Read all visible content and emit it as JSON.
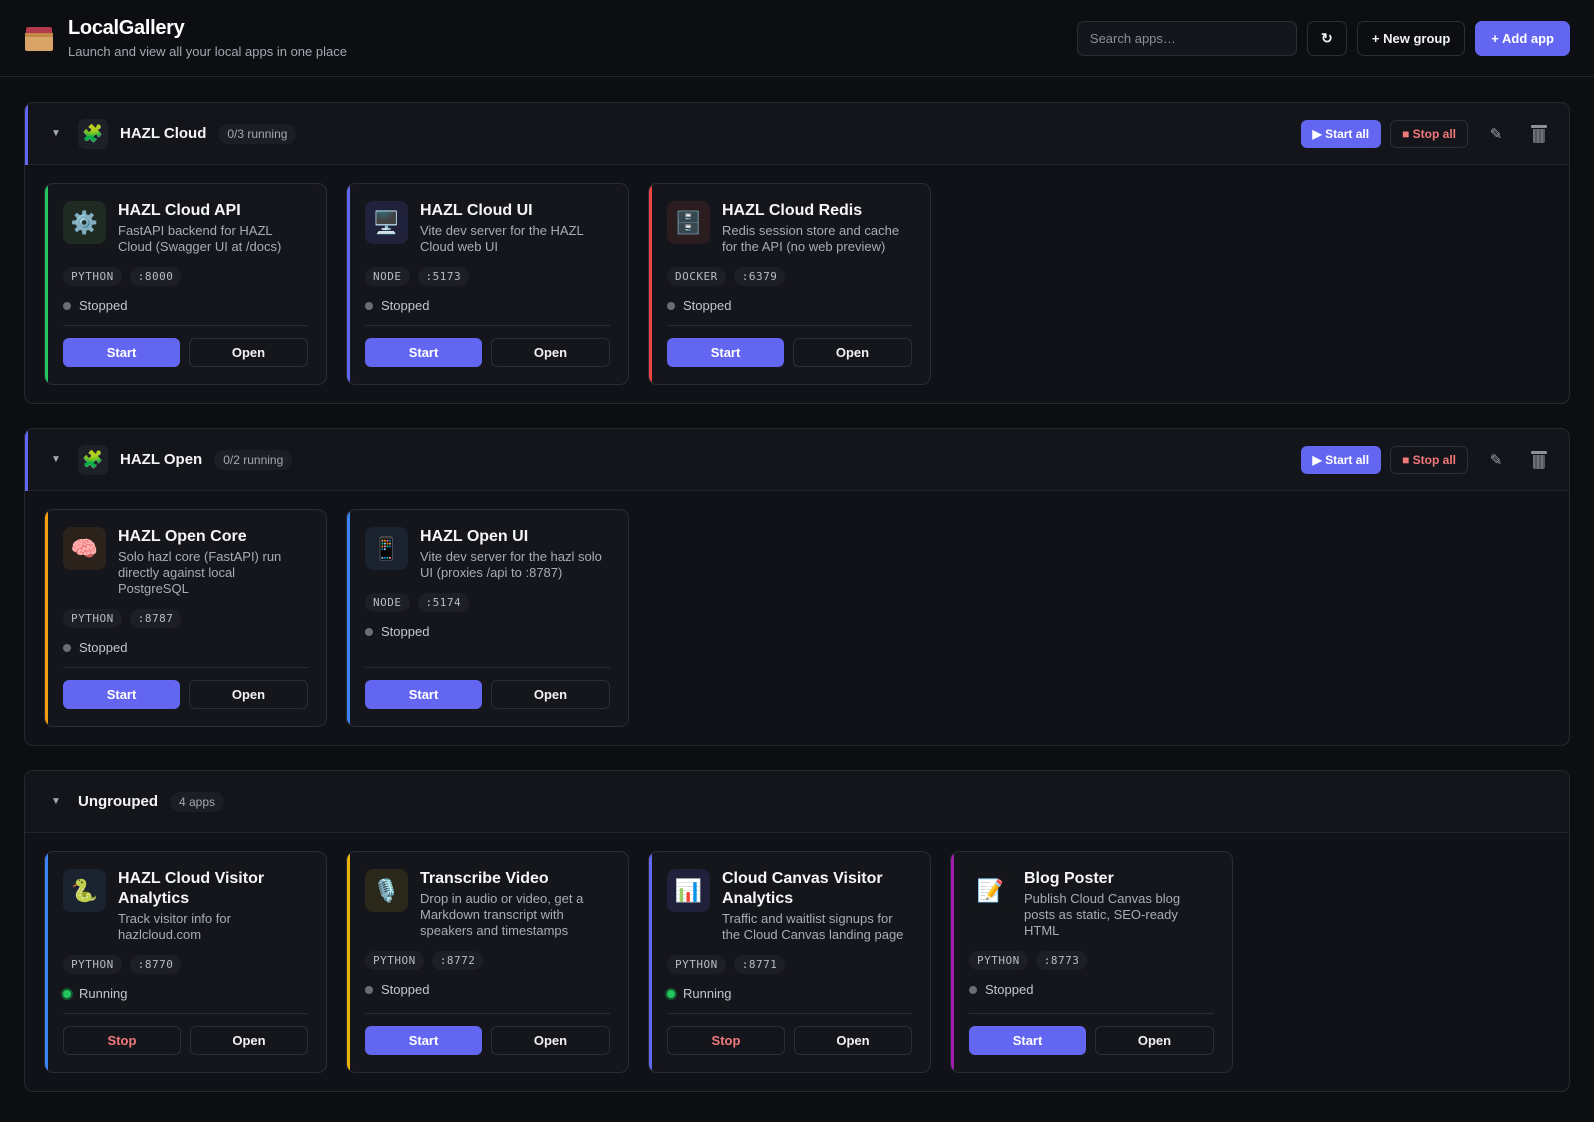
{
  "header": {
    "title": "LocalGallery",
    "subtitle": "Launch and view all your local apps in one place",
    "logo_icon": "card-file-box-icon",
    "search_placeholder": "Search apps…",
    "refresh_label": "↻",
    "new_group_label": "+ New group",
    "add_app_label": "+ Add app"
  },
  "groups": [
    {
      "name": "HAZL Cloud",
      "count": "0/3 running",
      "accent": "#6366f1",
      "start_all": "▶ Start all",
      "stop_all": "■ Stop all",
      "apps": [
        {
          "title": "HAZL Cloud API",
          "desc": "FastAPI backend for HAZL Cloud (Swagger UI at /docs)",
          "runtime": "PYTHON",
          "port": ":8000",
          "status": "Stopped",
          "action": "Start",
          "open": "Open",
          "accent": "#22c55e",
          "icon": "⚙️",
          "icon_bg": "#1f2a22"
        },
        {
          "title": "HAZL Cloud UI",
          "desc": "Vite dev server for the HAZL Cloud web UI",
          "runtime": "NODE",
          "port": ":5173",
          "status": "Stopped",
          "action": "Start",
          "open": "Open",
          "accent": "#6366f1",
          "icon": "🖥️",
          "icon_bg": "#20213a"
        },
        {
          "title": "HAZL Cloud Redis",
          "desc": "Redis session store and cache for the API (no web preview)",
          "runtime": "DOCKER",
          "port": ":6379",
          "status": "Stopped",
          "action": "Start",
          "open": "Open",
          "accent": "#ef4444",
          "icon": "🗄️",
          "icon_bg": "#2b1d1f"
        }
      ]
    },
    {
      "name": "HAZL Open",
      "count": "0/2 running",
      "accent": "#6366f1",
      "start_all": "▶ Start all",
      "stop_all": "■ Stop all",
      "apps": [
        {
          "title": "HAZL Open Core",
          "desc": "Solo hazl core (FastAPI) run directly against local PostgreSQL",
          "runtime": "PYTHON",
          "port": ":8787",
          "status": "Stopped",
          "action": "Start",
          "open": "Open",
          "accent": "#f59e0b",
          "icon": "🧠",
          "icon_bg": "#2b231b"
        },
        {
          "title": "HAZL Open UI",
          "desc": "Vite dev server for the hazl solo UI (proxies /api to :8787)",
          "runtime": "NODE",
          "port": ":5174",
          "status": "Stopped",
          "action": "Start",
          "open": "Open",
          "accent": "#3b82f6",
          "icon": "📱",
          "icon_bg": "#1b2330"
        }
      ]
    }
  ],
  "ungrouped": {
    "name": "Ungrouped",
    "count": "4 apps",
    "apps": [
      {
        "title": "HAZL Cloud Visitor Analytics",
        "desc": "Track visitor info for hazlcloud.com",
        "runtime": "PYTHON",
        "port": ":8770",
        "status": "Running",
        "action": "Stop",
        "open": "Open",
        "accent": "#3b82f6",
        "icon": "🐍",
        "icon_bg": "#1b2330"
      },
      {
        "title": "Transcribe Video",
        "desc": "Drop in audio or video, get a Markdown transcript with speakers and timestamps",
        "runtime": "PYTHON",
        "port": ":8772",
        "status": "Stopped",
        "action": "Start",
        "open": "Open",
        "accent": "#eab308",
        "icon": "🎙️",
        "icon_bg": "#2a281b"
      },
      {
        "title": "Cloud Canvas Visitor Analytics",
        "desc": "Traffic and waitlist signups for the Cloud Canvas landing page",
        "runtime": "PYTHON",
        "port": ":8771",
        "status": "Running",
        "action": "Stop",
        "open": "Open",
        "accent": "#6366f1",
        "icon": "📊",
        "icon_bg": "#20213a"
      },
      {
        "title": "Blog Poster",
        "desc": "Publish Cloud Canvas blog posts as static, SEO-ready HTML",
        "runtime": "PYTHON",
        "port": ":8773",
        "status": "Stopped",
        "action": "Start",
        "open": "Open",
        "accent": "#a21caf",
        "icon": "📝",
        "icon_bg": "#15161b"
      }
    ]
  }
}
